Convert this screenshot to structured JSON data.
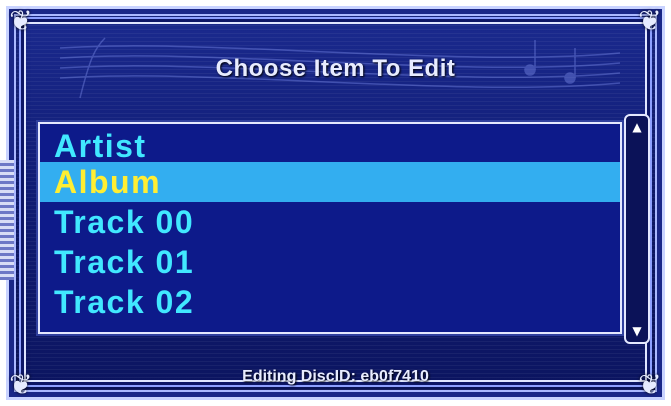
{
  "dialog": {
    "title": "Choose Item To Edit",
    "footer": "Editing DiscID: eb0f7410"
  },
  "list": {
    "items": [
      {
        "label": "Artist",
        "selected": false
      },
      {
        "label": "Album",
        "selected": true
      },
      {
        "label": "Track 00",
        "selected": false
      },
      {
        "label": "Track 01",
        "selected": false
      },
      {
        "label": "Track 02",
        "selected": false
      }
    ]
  },
  "scrollbar": {
    "up_icon": "▲",
    "down_icon": "▼"
  },
  "colors": {
    "background": "#0f1b72",
    "list_text": "#41e8ff",
    "selected_background": "#33aef0",
    "selected_text": "#ffee33"
  }
}
